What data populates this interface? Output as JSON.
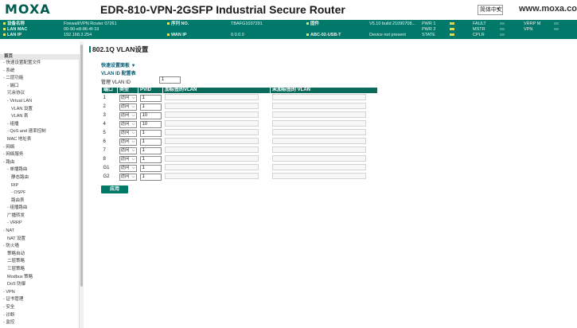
{
  "header": {
    "logo": "MOXA",
    "title": "EDR-810-VPN-2GSFP Industrial Secure Router",
    "language": "简体中文",
    "website": "www.moxa.com"
  },
  "status": {
    "device_name_label": "设备名称",
    "device_name": "Firewall/VPN Router 07261",
    "lan_mac_label": "LAN MAC",
    "lan_mac": "00-90-e8-86-4f-19",
    "lan_ip_label": "LAN IP",
    "lan_ip": "192.168.3.254",
    "serial_label": "序列 NO.",
    "serial": "TBAFG1037291",
    "wan_ip_label": "WAN IP",
    "wan_ip": "0.0.0.0",
    "firmware_label": "固件",
    "firmware": "V5.10 build 21090708...",
    "abc_label": "ABC-02-USB-T",
    "abc": "Device not present",
    "pwr1": "PWR 1",
    "pwr2": "PWR 2",
    "state": "STATE",
    "fault": "FAULT",
    "mstr": "MSTR",
    "cplr": "CPLR",
    "vrrp": "VRRP M",
    "vpn": "VPN"
  },
  "sidebar": {
    "head": "首页",
    "items": [
      {
        "label": "- 快速设置配置文件",
        "indent": 1
      },
      {
        "label": "- 系统",
        "indent": 1
      },
      {
        "label": "- 二层功能",
        "indent": 1
      },
      {
        "label": "- 端口",
        "indent": 2
      },
      {
        "label": "冗余协议",
        "indent": 2
      },
      {
        "label": "- Virtual LAN",
        "indent": 2
      },
      {
        "label": "VLAN 设置",
        "indent": 3
      },
      {
        "label": "VLAN 表",
        "indent": 3
      },
      {
        "label": "- 组播",
        "indent": 2
      },
      {
        "label": "- QoS and 速率控制",
        "indent": 2
      },
      {
        "label": "MAC 地址表",
        "indent": 2
      },
      {
        "label": "- 网络",
        "indent": 1
      },
      {
        "label": "- 网络服务",
        "indent": 1
      },
      {
        "label": "- 路由",
        "indent": 1
      },
      {
        "label": "- 单播路由",
        "indent": 2
      },
      {
        "label": "静态路由",
        "indent": 3
      },
      {
        "label": "RIP",
        "indent": 3
      },
      {
        "label": "- OSPF",
        "indent": 3
      },
      {
        "label": "路由表",
        "indent": 3
      },
      {
        "label": "- 组播路由",
        "indent": 2
      },
      {
        "label": "广播转发",
        "indent": 2
      },
      {
        "label": "- VRRP",
        "indent": 2
      },
      {
        "label": "- NAT",
        "indent": 1
      },
      {
        "label": "NAT 设置",
        "indent": 2
      },
      {
        "label": "- 防火墙",
        "indent": 1
      },
      {
        "label": "策略自动",
        "indent": 2
      },
      {
        "label": "二层策略",
        "indent": 2
      },
      {
        "label": "三层策略",
        "indent": 2
      },
      {
        "label": "Modbus 策略",
        "indent": 2
      },
      {
        "label": "DoS 防御",
        "indent": 2
      },
      {
        "label": "- VPN",
        "indent": 1
      },
      {
        "label": "- 证书管理",
        "indent": 1
      },
      {
        "label": "- 安全",
        "indent": 1
      },
      {
        "label": "- 诊断",
        "indent": 1
      },
      {
        "label": "- 监控",
        "indent": 1
      }
    ]
  },
  "main": {
    "page_title": "802.1Q VLAN设置",
    "quick_panel": "快速设置面板 ▼",
    "vlan_cfg_title": "VLAN ID 配置表",
    "mgmt_label": "管理 VLAN ID",
    "mgmt_value": "1",
    "columns": [
      "端口",
      "类型",
      "PVID",
      "加标签的VLAN",
      "未加标签的 VLAN"
    ],
    "rows": [
      {
        "port": "1",
        "type": "访问",
        "pvid": "1"
      },
      {
        "port": "2",
        "type": "访问",
        "pvid": "1"
      },
      {
        "port": "3",
        "type": "访问",
        "pvid": "10"
      },
      {
        "port": "4",
        "type": "访问",
        "pvid": "10"
      },
      {
        "port": "5",
        "type": "访问",
        "pvid": "1"
      },
      {
        "port": "6",
        "type": "访问",
        "pvid": "1"
      },
      {
        "port": "7",
        "type": "访问",
        "pvid": "1"
      },
      {
        "port": "8",
        "type": "访问",
        "pvid": "1"
      },
      {
        "port": "G1",
        "type": "访问",
        "pvid": "1"
      },
      {
        "port": "G2",
        "type": "访问",
        "pvid": "1"
      }
    ],
    "apply_label": "应用"
  }
}
